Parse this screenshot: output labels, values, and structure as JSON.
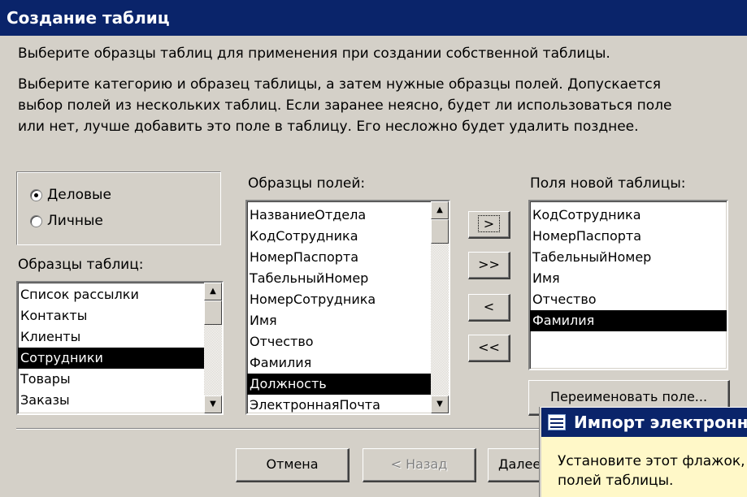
{
  "window": {
    "title": "Создание таблиц"
  },
  "intro": {
    "line1": "Выберите образцы таблиц для применения при создании собственной таблицы.",
    "line2": "Выберите категорию и образец таблицы, а затем нужные образцы полей. Допускается",
    "line3": "выбор полей из нескольких таблиц. Если заранее неясно, будет ли использоваться поле",
    "line4": "или нет, лучше добавить это поле в таблицу. Его несложно будет удалить позднее."
  },
  "category": {
    "options": [
      {
        "label": "Деловые",
        "selected": true
      },
      {
        "label": "Личные",
        "selected": false
      }
    ]
  },
  "sample_tables": {
    "label": "Образцы таблиц:",
    "items": [
      "Список рассылки",
      "Контакты",
      "Клиенты",
      "Сотрудники",
      "Товары",
      "Заказы"
    ],
    "selected_index": 3
  },
  "sample_fields": {
    "label": "Образцы полей:",
    "items": [
      "НазваниеОтдела",
      "КодСотрудника",
      "НомерПаспорта",
      "ТабельныйНомер",
      "НомерСотрудника",
      "Имя",
      "Отчество",
      "Фамилия",
      "Должность",
      "ЭлектроннаяПочта"
    ],
    "selected_index": 8
  },
  "move_buttons": {
    "add_one": ">",
    "add_all": ">>",
    "remove_one": "<",
    "remove_all": "<<"
  },
  "new_fields": {
    "label": "Поля новой таблицы:",
    "items": [
      "КодСотрудника",
      "НомерПаспорта",
      "ТабельныйНомер",
      "Имя",
      "Отчество",
      "Фамилия"
    ],
    "selected_index": 5
  },
  "rename_button": "Переименовать поле...",
  "footer": {
    "cancel": "Отмена",
    "back": "< Назад",
    "next": "Далее >"
  },
  "popup": {
    "title": "Импорт электронной таблицы",
    "text1": "Установите этот флажок,",
    "text2": "полей таблицы."
  }
}
